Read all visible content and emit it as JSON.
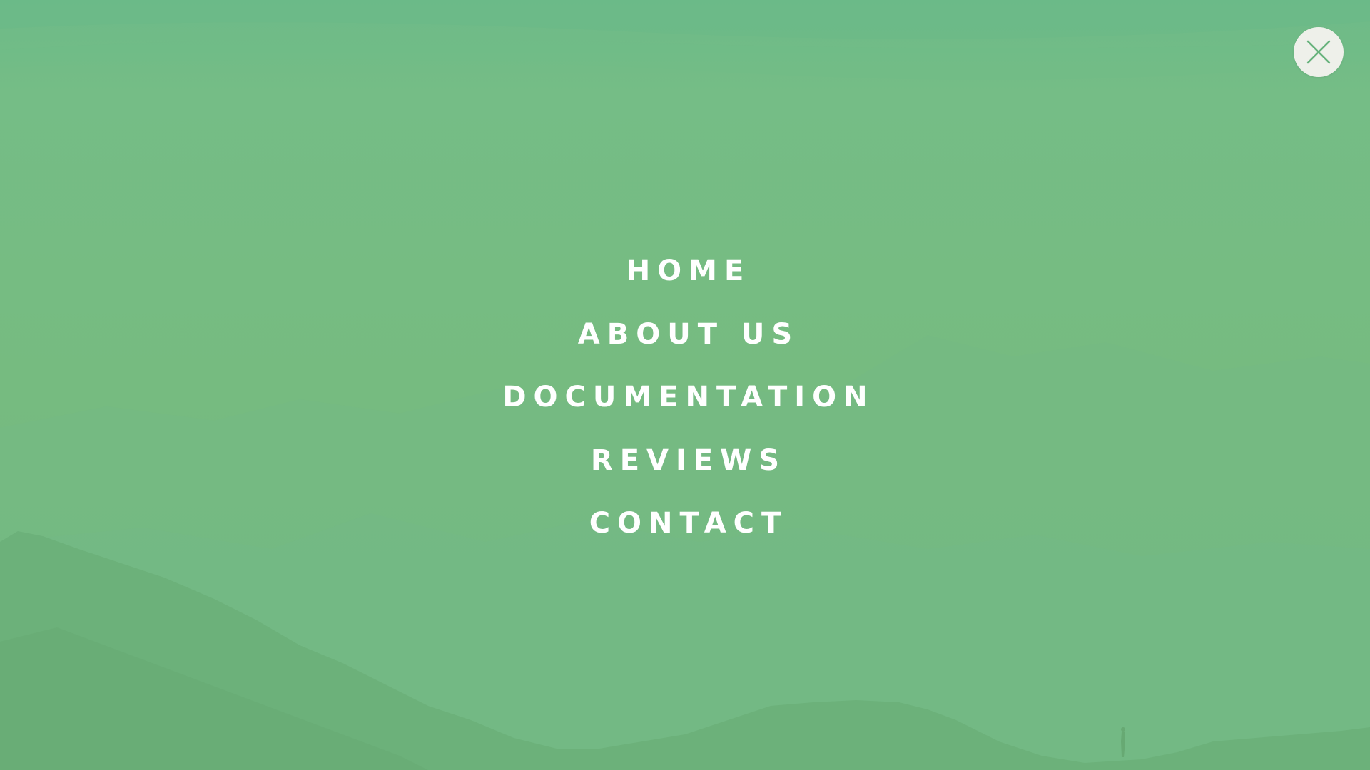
{
  "colors": {
    "background_top": "#6dba88",
    "background_bottom": "#6db37a",
    "menu_text": "#ffffff",
    "close_button_bg": "#eef0ea",
    "close_icon": "#67b27c"
  },
  "close_button": {
    "icon": "close-icon"
  },
  "menu": {
    "items": [
      {
        "label": "HOME"
      },
      {
        "label": "ABOUT US"
      },
      {
        "label": "DOCUMENTATION"
      },
      {
        "label": "REVIEWS"
      },
      {
        "label": "CONTACT"
      }
    ]
  }
}
